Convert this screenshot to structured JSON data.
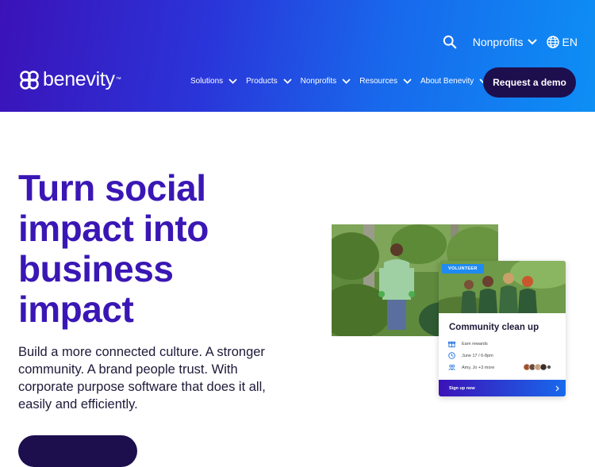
{
  "header": {
    "logo_text": "benevity",
    "logo_tm": "™",
    "top_links": {
      "search_icon": "search-icon",
      "audience_label": "Nonprofits",
      "language_label": "EN"
    },
    "nav": [
      {
        "label": "Solutions"
      },
      {
        "label": "Products"
      },
      {
        "label": "Nonprofits"
      },
      {
        "label": "Resources"
      },
      {
        "label": "About Benevity"
      }
    ],
    "cta_label": "Request a demo"
  },
  "hero": {
    "title": "Turn social impact into business impact",
    "subtitle": "Build a more connected culture. A stronger community. A brand people trust. With corporate purpose software that does it all, easily and efficiently."
  },
  "card": {
    "tag": "VOLUNTEER",
    "title": "Community clean up",
    "rows": [
      {
        "icon": "gift-icon",
        "text": "Earn rewards"
      },
      {
        "icon": "clock-icon",
        "text": "June 17 / 6-8pm"
      },
      {
        "icon": "people-icon",
        "text": "Amy, Jo +3 more"
      }
    ],
    "cta": "Sign up now"
  },
  "colors": {
    "brand_purple": "#3a17b5",
    "dark_navy": "#1d0f4e",
    "accent_blue": "#1f8bf2"
  }
}
